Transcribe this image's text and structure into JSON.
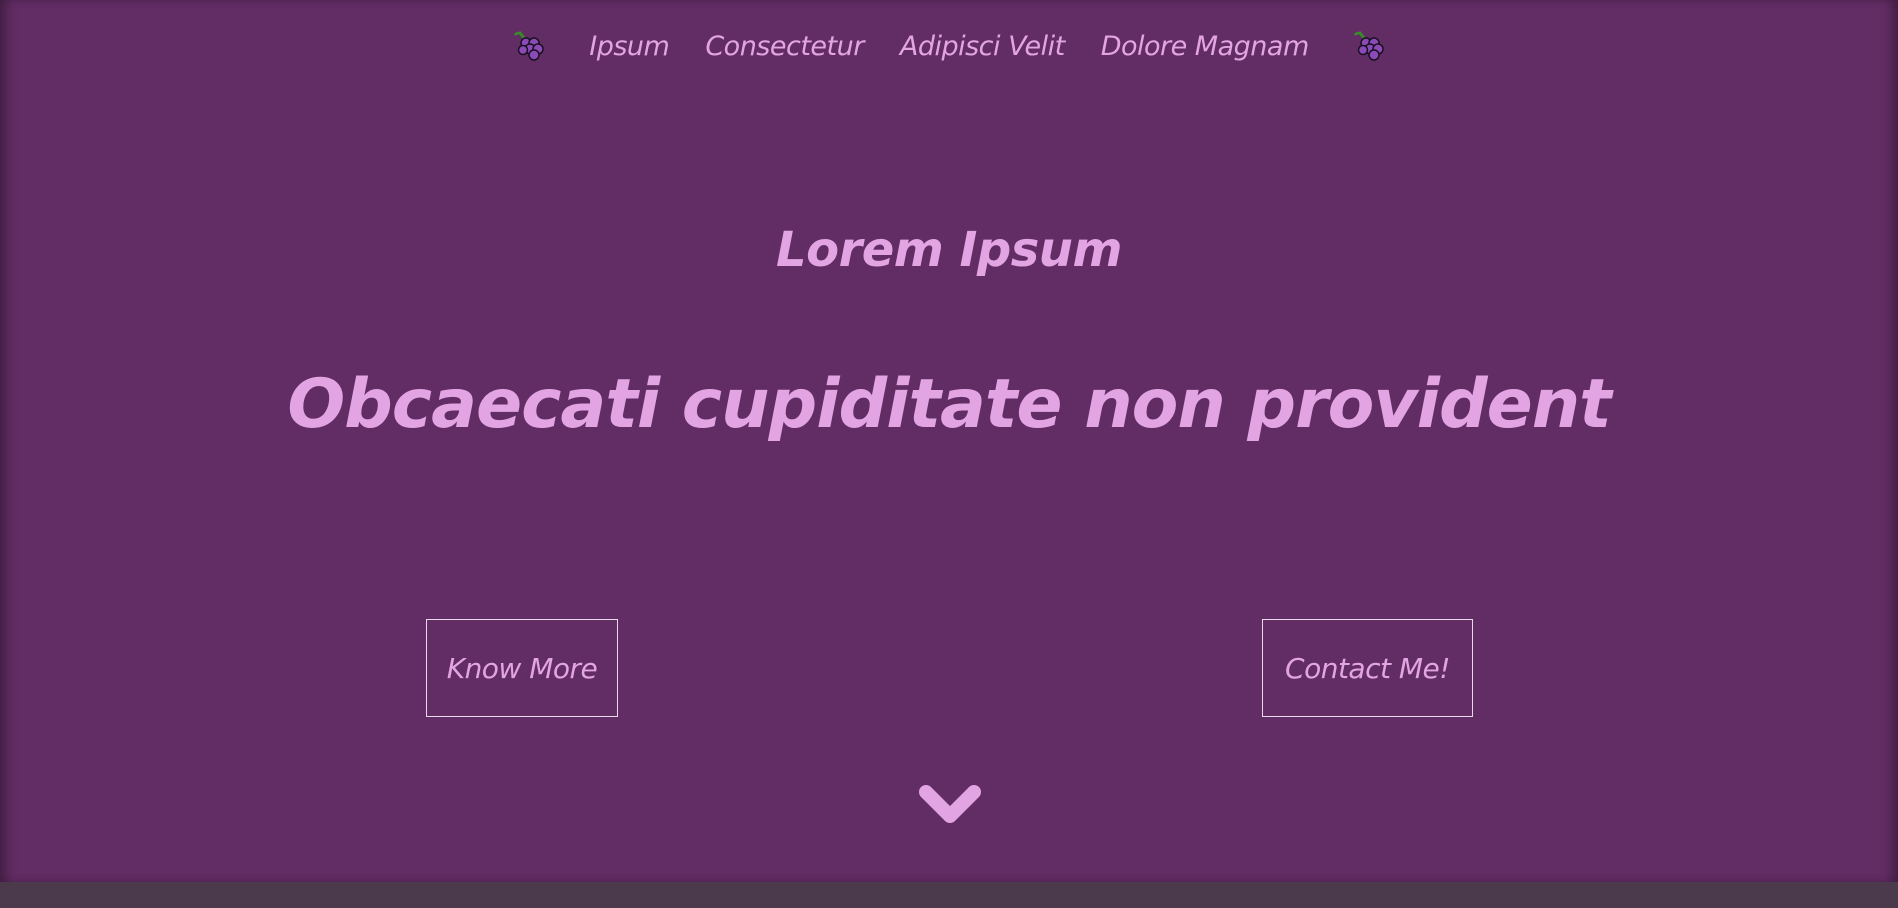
{
  "nav": {
    "logo_left_icon": "grapes-icon",
    "logo_right_icon": "grapes-icon",
    "items": [
      {
        "label": "Ipsum"
      },
      {
        "label": "Consectetur"
      },
      {
        "label": "Adipisci Velit"
      },
      {
        "label": "Dolore Magnam"
      }
    ]
  },
  "hero": {
    "subtitle": "Lorem Ipsum",
    "title": "Obcaecati cupiditate non provident",
    "buttons": {
      "know_more": "Know More",
      "contact": "Contact Me!"
    },
    "scroll_icon": "chevron-down-icon"
  },
  "colors": {
    "background": "#622d64",
    "page_bottom": "#4a3a4c",
    "text": "#e3a4e3",
    "button_border": "#e8d8ea"
  }
}
